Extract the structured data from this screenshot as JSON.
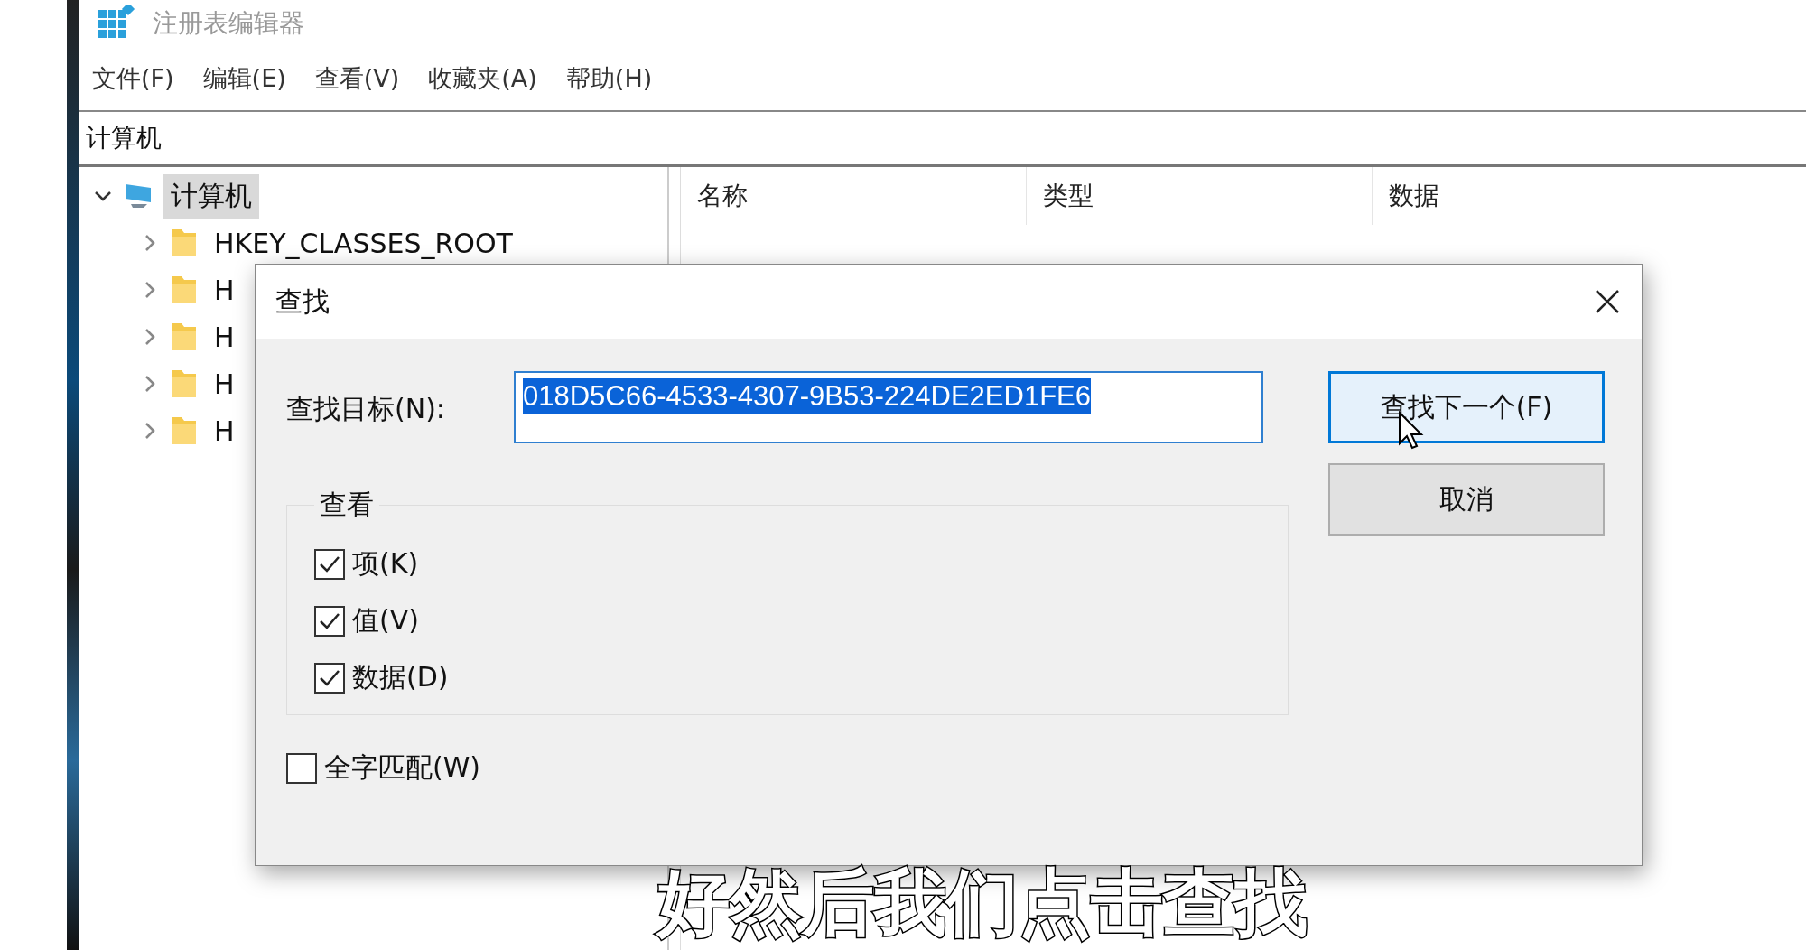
{
  "window": {
    "title": "注册表编辑器"
  },
  "menu": [
    "文件(F)",
    "编辑(E)",
    "查看(V)",
    "收藏夹(A)",
    "帮助(H)"
  ],
  "address_bar": {
    "value": "计算机"
  },
  "tree": [
    {
      "label": "计算机",
      "expanded": true,
      "selected": true,
      "children": [
        {
          "label": "HKEY_CLASSES_ROOT",
          "expanded": false,
          "selected": false
        },
        {
          "label": "H",
          "expanded": false,
          "selected": false
        },
        {
          "label": "H",
          "expanded": false,
          "selected": false
        },
        {
          "label": "H",
          "expanded": false,
          "selected": false
        },
        {
          "label": "H",
          "expanded": false,
          "selected": false
        }
      ]
    }
  ],
  "list": {
    "columns": [
      "名称",
      "类型",
      "数据"
    ]
  },
  "find_dialog": {
    "title": "查找",
    "target_label": "查找目标(N):",
    "target_value": "018D5C66-4533-4307-9B53-224DE2ED1FE6",
    "value_selected": true,
    "buttons": [
      {
        "label": "查找下一个(F)",
        "default": true
      },
      {
        "label": "取消",
        "default": false
      }
    ],
    "look_in": {
      "label": "查看",
      "options": [
        {
          "label": "项(K)",
          "checked": true
        },
        {
          "label": "值(V)",
          "checked": true
        },
        {
          "label": "数据(D)",
          "checked": true
        }
      ]
    },
    "match_whole": {
      "label": "全字匹配(W)",
      "checked": false
    }
  },
  "subtitle": "好然后我们点击查找"
}
